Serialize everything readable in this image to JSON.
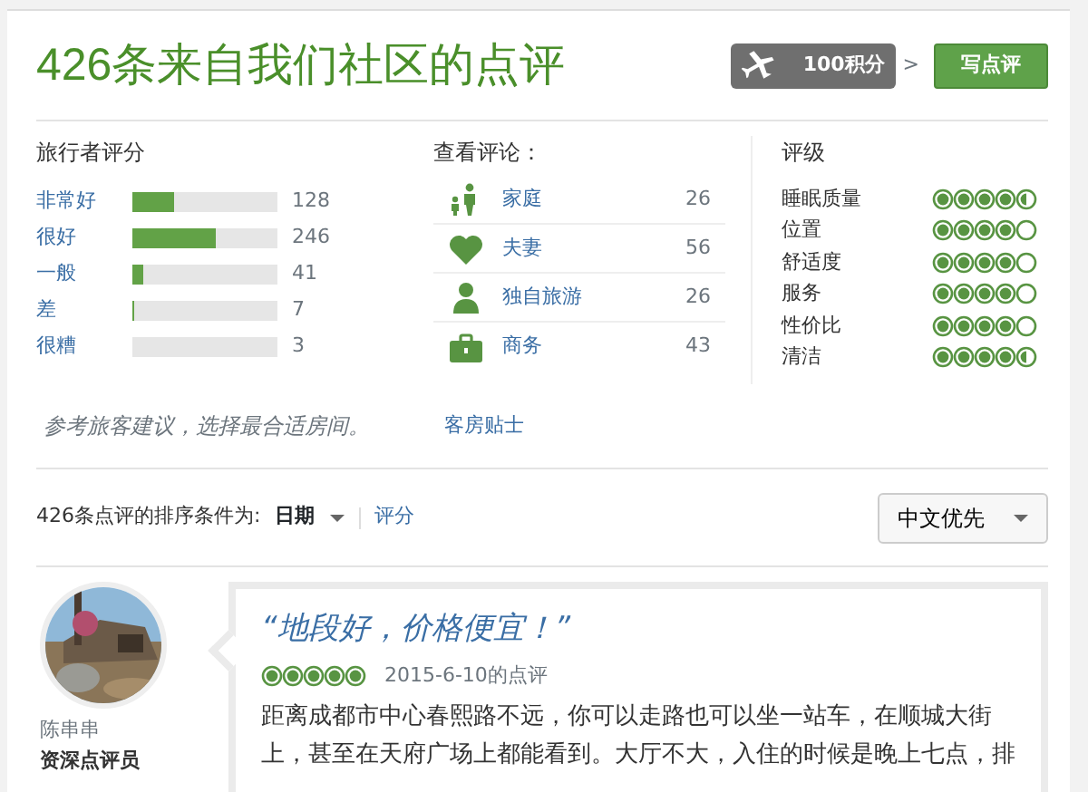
{
  "header": {
    "title": "426条来自我们社区的点评",
    "points_badge": "100积分",
    "arrow": ">",
    "write_button": "写点评"
  },
  "traveler_ratings": {
    "heading": "旅行者评分",
    "rows": [
      {
        "label": "非常好",
        "level": 0.29,
        "count": "128"
      },
      {
        "label": "很好",
        "level": 0.57,
        "count": "246"
      },
      {
        "label": "一般",
        "level": 0.08,
        "count": "41"
      },
      {
        "label": "差",
        "level": 0.01,
        "count": "7"
      },
      {
        "label": "很糟",
        "level": 0,
        "count": "3"
      }
    ]
  },
  "view_reviews": {
    "heading": "查看评论：",
    "rows": [
      {
        "kind": "family",
        "label": "家庭",
        "count": "26"
      },
      {
        "kind": "couple",
        "label": "夫妻",
        "count": "56"
      },
      {
        "kind": "solo",
        "label": "独自旅游",
        "count": "26"
      },
      {
        "kind": "business",
        "label": "商务",
        "count": "43"
      }
    ]
  },
  "grades": {
    "heading": "评级",
    "rows": [
      {
        "label": "睡眠质量",
        "stars": 4.5
      },
      {
        "label": "位置",
        "stars": 4
      },
      {
        "label": "舒适度",
        "stars": 4
      },
      {
        "label": "服务",
        "stars": 4
      },
      {
        "label": "性价比",
        "stars": 4
      },
      {
        "label": "清洁",
        "stars": 4.5
      }
    ]
  },
  "tip": {
    "text": "参考旅客建议，选择最合适房间。",
    "link": "客房贴士"
  },
  "sort": {
    "label": "426条点评的排序条件为:",
    "options": [
      {
        "label": "日期",
        "selected": true
      },
      {
        "label": "评分",
        "selected": false
      }
    ],
    "language": "中文优先"
  },
  "review": {
    "user": "陈串串",
    "level": "资深点评员",
    "title": "“地段好，价格便宜！”",
    "stars": 5,
    "date": "2015-6-10的点评",
    "lines": [
      "距离成都市中心春熙路不远，你可以走路也可以坐一站车，在顺城大街",
      "上，甚至在天府广场上都能看到。大厅不大，入住的时候是晚上七点，排"
    ]
  }
}
